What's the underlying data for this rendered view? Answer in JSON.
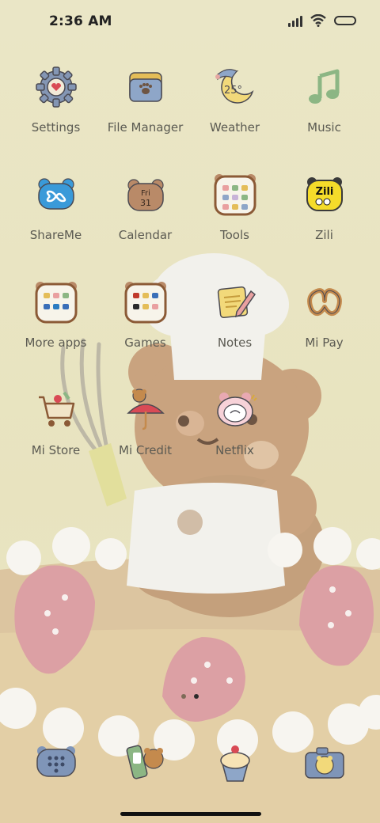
{
  "status_bar": {
    "time": "2:36 AM"
  },
  "apps": [
    {
      "label": "Settings",
      "icon": "settings-gear-icon"
    },
    {
      "label": "File Manager",
      "icon": "folder-icon"
    },
    {
      "label": "Weather",
      "icon": "weather-moon-icon",
      "temp": "25°"
    },
    {
      "label": "Music",
      "icon": "music-note-icon"
    },
    {
      "label": "ShareMe",
      "icon": "shareme-infinity-icon"
    },
    {
      "label": "Calendar",
      "icon": "calendar-bear-icon",
      "day": "Fri",
      "date": "31"
    },
    {
      "label": "Tools",
      "icon": "tools-folder-icon"
    },
    {
      "label": "Zili",
      "icon": "zili-icon",
      "text": "Zili"
    },
    {
      "label": "More apps",
      "icon": "more-apps-folder-icon"
    },
    {
      "label": "Games",
      "icon": "games-folder-icon"
    },
    {
      "label": "Notes",
      "icon": "notes-pencil-icon"
    },
    {
      "label": "Mi Pay",
      "icon": "pretzel-icon"
    },
    {
      "label": "Mi Store",
      "icon": "shopping-cart-icon"
    },
    {
      "label": "Mi Credit",
      "icon": "umbrella-bear-icon"
    },
    {
      "label": "Netflix",
      "icon": "netflix-pig-icon"
    }
  ],
  "dock": [
    {
      "icon": "phone-dialpad-icon"
    },
    {
      "icon": "messages-phone-icon"
    },
    {
      "icon": "cupcake-browser-icon"
    },
    {
      "icon": "camera-bear-icon"
    }
  ],
  "page_indicator": {
    "pages": 2,
    "active": 2
  },
  "colors": {
    "background": "#eae6c6",
    "label": "#5b5a52",
    "bear": "#c9a37f",
    "strawberry": "#dca0a4"
  }
}
